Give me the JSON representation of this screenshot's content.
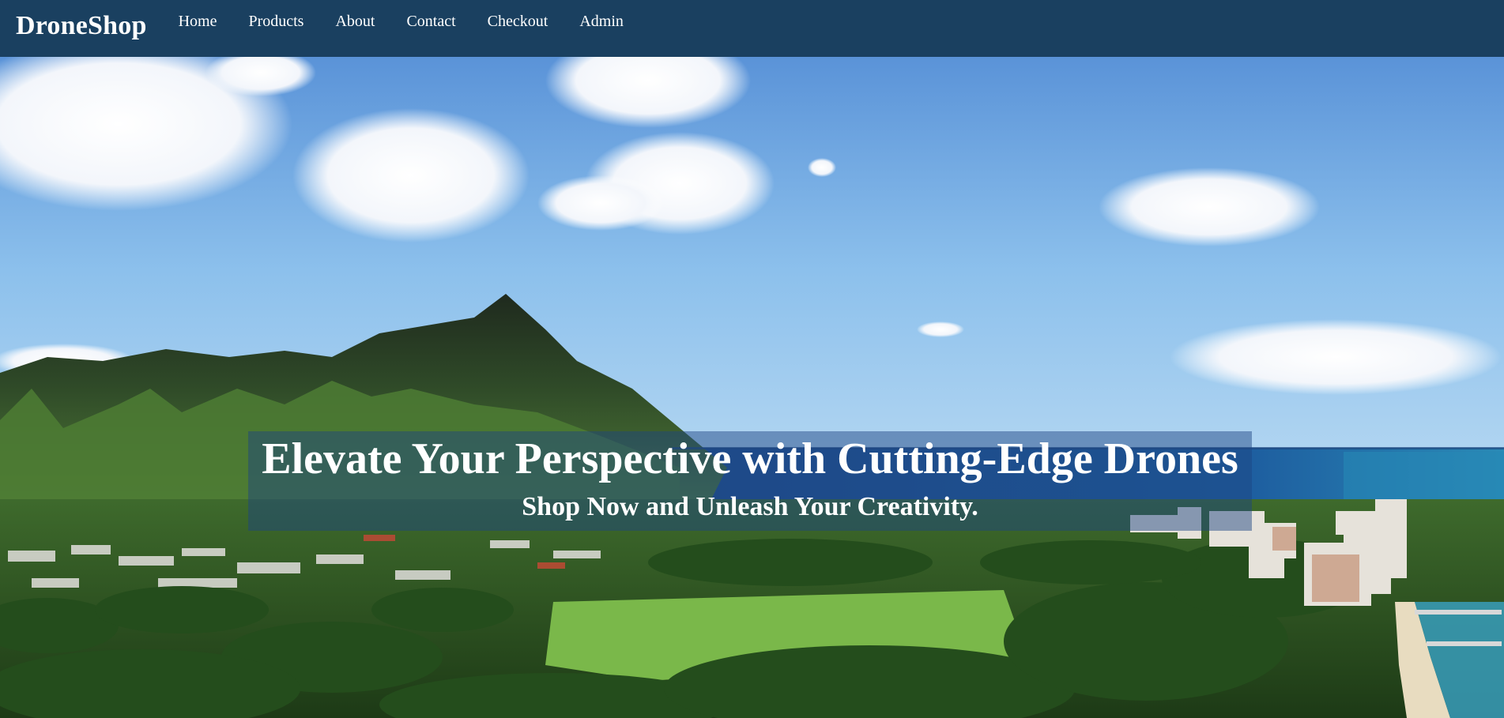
{
  "navbar": {
    "brand": "DroneShop",
    "links": [
      {
        "label": "Home"
      },
      {
        "label": "Products"
      },
      {
        "label": "About"
      },
      {
        "label": "Contact"
      },
      {
        "label": "Checkout"
      },
      {
        "label": "Admin"
      }
    ],
    "background_color": "#1a4060"
  },
  "hero": {
    "title": "Elevate Your Perspective with Cutting-Edge Drones",
    "subtitle": "Shop Now and Unleash Your Creativity.",
    "background_image": "aerial-coastline-mountain-photo"
  }
}
